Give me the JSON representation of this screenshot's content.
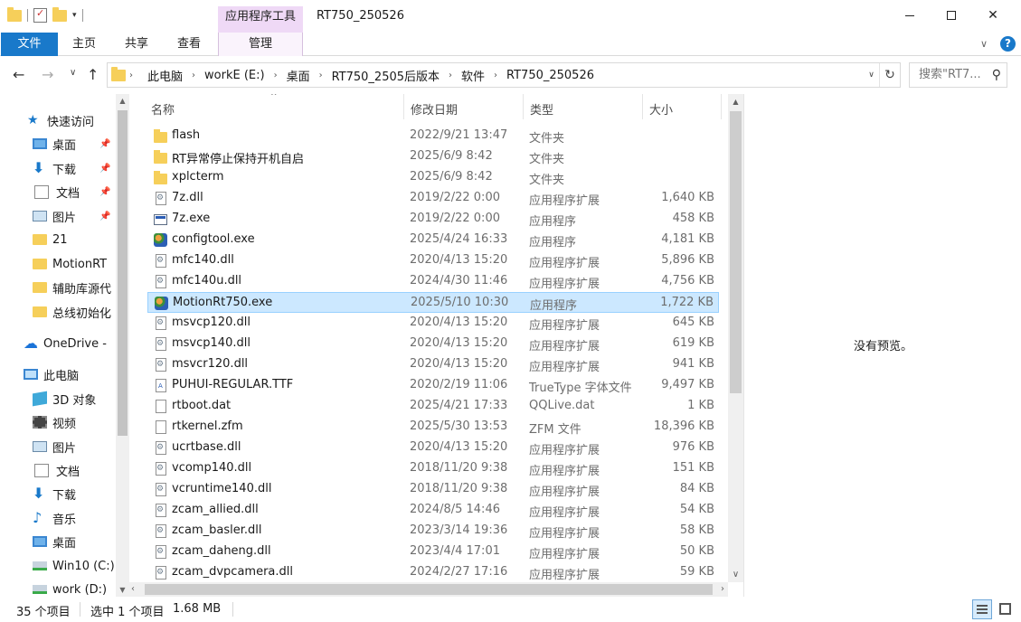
{
  "window": {
    "title": "RT750_250526",
    "contextual_tab_group": "应用程序工具"
  },
  "ribbon": {
    "tabs": [
      "文件",
      "主页",
      "共享",
      "查看",
      "管理"
    ],
    "active_tab": "文件"
  },
  "address": {
    "crumbs": [
      "此电脑",
      "workE (E:)",
      "桌面",
      "RT750_2505后版本",
      "软件",
      "RT750_250526"
    ],
    "search_placeholder": "搜索\"RT7..."
  },
  "nav_pane": {
    "items": [
      {
        "label": "快速访问",
        "icon": "star-icon",
        "pinned": false
      },
      {
        "label": "桌面",
        "icon": "desktop-icon",
        "pinned": true
      },
      {
        "label": "下载",
        "icon": "download-icon",
        "pinned": true
      },
      {
        "label": "文档",
        "icon": "document-icon",
        "pinned": true
      },
      {
        "label": "图片",
        "icon": "pictures-icon",
        "pinned": true
      },
      {
        "label": "21",
        "icon": "folder-icon",
        "pinned": false
      },
      {
        "label": "MotionRT",
        "icon": "folder-icon",
        "pinned": false
      },
      {
        "label": "辅助库源代",
        "icon": "folder-icon",
        "pinned": false
      },
      {
        "label": "总线初始化",
        "icon": "folder-icon",
        "pinned": false
      },
      {
        "label": "OneDrive -",
        "icon": "onedrive-icon",
        "pinned": false
      },
      {
        "label": "此电脑",
        "icon": "this-pc-icon",
        "pinned": false
      },
      {
        "label": "3D 对象",
        "icon": "3d-objects-icon",
        "pinned": false
      },
      {
        "label": "视频",
        "icon": "video-icon",
        "pinned": false
      },
      {
        "label": "图片",
        "icon": "pictures-icon",
        "pinned": false
      },
      {
        "label": "文档",
        "icon": "document-icon",
        "pinned": false
      },
      {
        "label": "下载",
        "icon": "download-icon",
        "pinned": false
      },
      {
        "label": "音乐",
        "icon": "music-icon",
        "pinned": false
      },
      {
        "label": "桌面",
        "icon": "desktop-icon",
        "pinned": false
      },
      {
        "label": "Win10 (C:)",
        "icon": "drive-icon",
        "pinned": false
      },
      {
        "label": "work (D:)",
        "icon": "drive-icon",
        "pinned": false
      }
    ]
  },
  "columns": {
    "name": "名称",
    "date": "修改日期",
    "type": "类型",
    "size": "大小"
  },
  "files": [
    {
      "name": "flash",
      "date": "2022/9/21 13:47",
      "type": "文件夹",
      "size": "",
      "icon": "folder-icon"
    },
    {
      "name": "RT异常停止保持开机自启",
      "date": "2025/6/9 8:42",
      "type": "文件夹",
      "size": "",
      "icon": "folder-icon"
    },
    {
      "name": "xplcterm",
      "date": "2025/6/9 8:42",
      "type": "文件夹",
      "size": "",
      "icon": "folder-icon"
    },
    {
      "name": "7z.dll",
      "date": "2019/2/22 0:00",
      "type": "应用程序扩展",
      "size": "1,640 KB",
      "icon": "dll-icon"
    },
    {
      "name": "7z.exe",
      "date": "2019/2/22 0:00",
      "type": "应用程序",
      "size": "458 KB",
      "icon": "exe-icon"
    },
    {
      "name": "configtool.exe",
      "date": "2025/4/24 16:33",
      "type": "应用程序",
      "size": "4,181 KB",
      "icon": "app-icon"
    },
    {
      "name": "mfc140.dll",
      "date": "2020/4/13 15:20",
      "type": "应用程序扩展",
      "size": "5,896 KB",
      "icon": "dll-icon"
    },
    {
      "name": "mfc140u.dll",
      "date": "2024/4/30 11:46",
      "type": "应用程序扩展",
      "size": "4,756 KB",
      "icon": "dll-icon"
    },
    {
      "name": "MotionRt750.exe",
      "date": "2025/5/10 10:30",
      "type": "应用程序",
      "size": "1,722 KB",
      "icon": "app-icon",
      "selected": true
    },
    {
      "name": "msvcp120.dll",
      "date": "2020/4/13 15:20",
      "type": "应用程序扩展",
      "size": "645 KB",
      "icon": "dll-icon"
    },
    {
      "name": "msvcp140.dll",
      "date": "2020/4/13 15:20",
      "type": "应用程序扩展",
      "size": "619 KB",
      "icon": "dll-icon"
    },
    {
      "name": "msvcr120.dll",
      "date": "2020/4/13 15:20",
      "type": "应用程序扩展",
      "size": "941 KB",
      "icon": "dll-icon"
    },
    {
      "name": "PUHUI-REGULAR.TTF",
      "date": "2020/2/19 11:06",
      "type": "TrueType 字体文件",
      "size": "9,497 KB",
      "icon": "font-file-icon"
    },
    {
      "name": "rtboot.dat",
      "date": "2025/4/21 17:33",
      "type": "QQLive.dat",
      "size": "1 KB",
      "icon": "file-icon"
    },
    {
      "name": "rtkernel.zfm",
      "date": "2025/5/30 13:53",
      "type": "ZFM 文件",
      "size": "18,396 KB",
      "icon": "file-icon"
    },
    {
      "name": "ucrtbase.dll",
      "date": "2020/4/13 15:20",
      "type": "应用程序扩展",
      "size": "976 KB",
      "icon": "dll-icon"
    },
    {
      "name": "vcomp140.dll",
      "date": "2018/11/20 9:38",
      "type": "应用程序扩展",
      "size": "151 KB",
      "icon": "dll-icon"
    },
    {
      "name": "vcruntime140.dll",
      "date": "2018/11/20 9:38",
      "type": "应用程序扩展",
      "size": "84 KB",
      "icon": "dll-icon"
    },
    {
      "name": "zcam_allied.dll",
      "date": "2024/8/5 14:46",
      "type": "应用程序扩展",
      "size": "54 KB",
      "icon": "dll-icon"
    },
    {
      "name": "zcam_basler.dll",
      "date": "2023/3/14 19:36",
      "type": "应用程序扩展",
      "size": "58 KB",
      "icon": "dll-icon"
    },
    {
      "name": "zcam_daheng.dll",
      "date": "2023/4/4 17:01",
      "type": "应用程序扩展",
      "size": "50 KB",
      "icon": "dll-icon"
    },
    {
      "name": "zcam_dvpcamera.dll",
      "date": "2024/2/27 17:16",
      "type": "应用程序扩展",
      "size": "59 KB",
      "icon": "dll-icon"
    }
  ],
  "preview": {
    "empty_text": "没有预览。"
  },
  "status": {
    "item_count": "35 个项目",
    "selection": "选中 1 个项目",
    "selection_size": "1.68 MB"
  }
}
